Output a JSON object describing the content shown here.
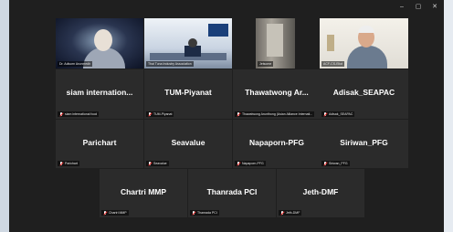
{
  "window_controls": [
    "–",
    "▢",
    "✕"
  ],
  "row1": [
    {
      "label": "Dr. Adisorn Arunmedh",
      "video": "v1"
    },
    {
      "label": "Thai Tuna Industry Association",
      "video": "v2"
    },
    {
      "label": "Jetsome",
      "video": "v3"
    },
    {
      "label": "ACF-CS-Eliot",
      "video": "v4",
      "speaking": true
    }
  ],
  "row2": [
    {
      "name": "siam  internation...",
      "label": "siam international food"
    },
    {
      "name": "TUM-Piyanat",
      "label": "TUM-Piyanat"
    },
    {
      "name": "Thawatwong  Ar...",
      "label": "Thawatwong Arunthong (Asian Alliance Internati..."
    },
    {
      "name": "Adisak_SEAPAC",
      "label": "Adisak_SEAPAC"
    }
  ],
  "row3": [
    {
      "name": "Parichart",
      "label": "Parichart"
    },
    {
      "name": "Seavalue",
      "label": "Seavalue"
    },
    {
      "name": "Napaporn-PFG",
      "label": "Napaporn-PFG"
    },
    {
      "name": "Siriwan_PFG",
      "label": "Siriwan_PFG"
    }
  ],
  "row4": [
    {
      "name": "Chartri MMP",
      "label": "Chartri MMP"
    },
    {
      "name": "Thanrada PCI",
      "label": "Thanrada PCI"
    },
    {
      "name": "Jeth-DMF",
      "label": "Jeth-DMF"
    }
  ],
  "colors": {
    "speaking_border": "#5ed19a",
    "tile_bg": "#2b2b2b",
    "window_bg": "#1f1f1f"
  }
}
